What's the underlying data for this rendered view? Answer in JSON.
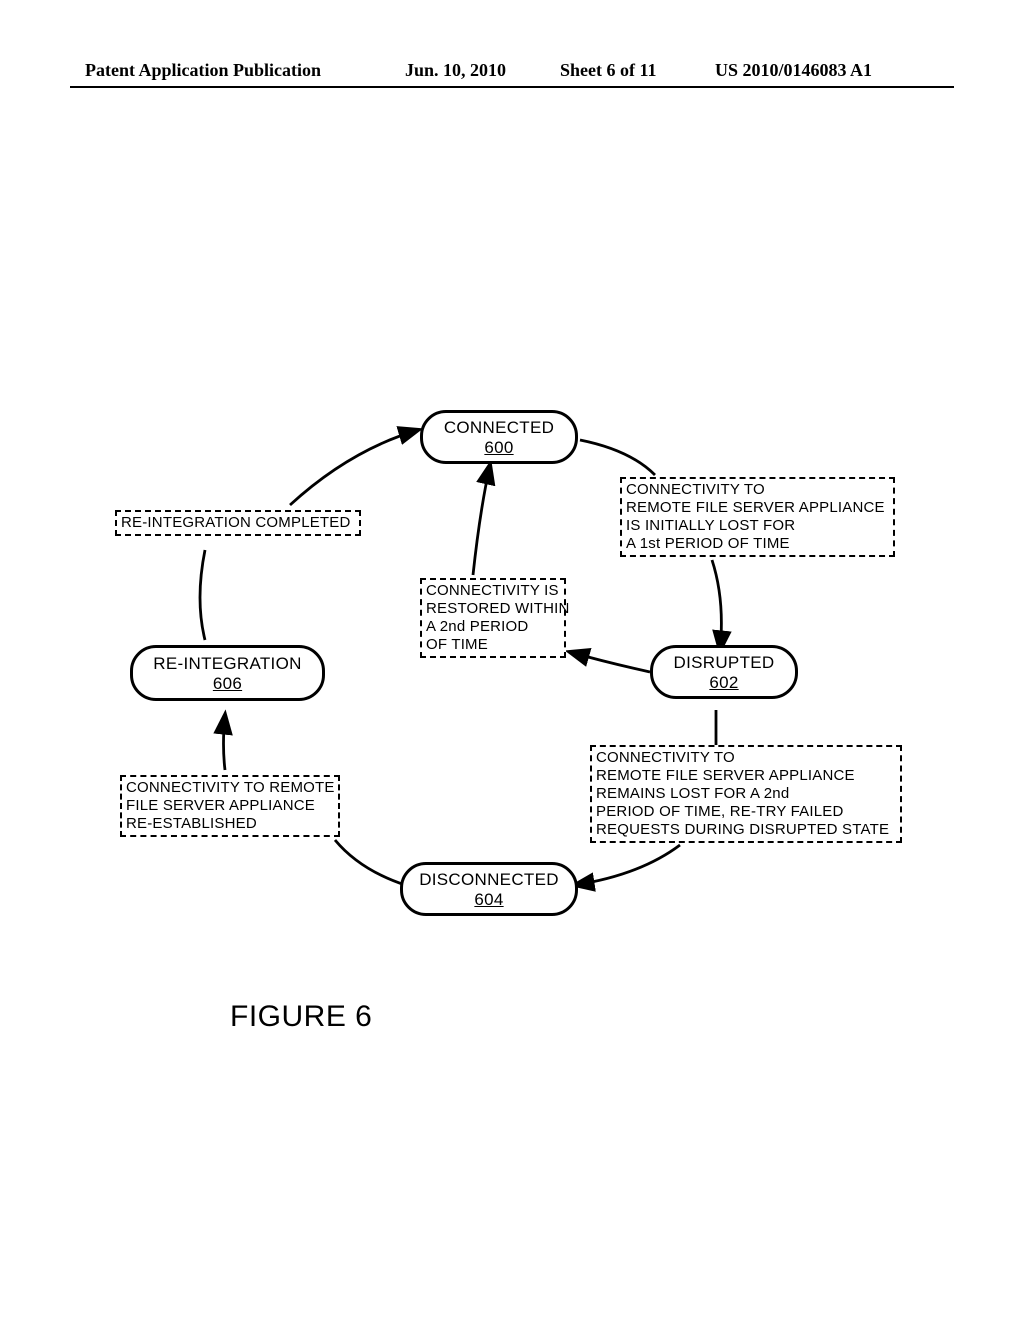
{
  "header": {
    "left": "Patent Application Publication",
    "date": "Jun. 10, 2010",
    "sheet": "Sheet 6 of 11",
    "pub_number": "US 2010/0146083 A1"
  },
  "figure_caption": "FIGURE 6",
  "chart_data": {
    "type": "state-diagram",
    "states": [
      {
        "id": "600",
        "name": "CONNECTED",
        "ref": "600"
      },
      {
        "id": "602",
        "name": "DISRUPTED",
        "ref": "602"
      },
      {
        "id": "604",
        "name": "DISCONNECTED",
        "ref": "604"
      },
      {
        "id": "606",
        "name": "RE-INTEGRATION",
        "ref": "606"
      }
    ],
    "transitions": [
      {
        "from": "600",
        "to": "602",
        "label": "CONNECTIVITY TO\nREMOTE FILE SERVER APPLIANCE\nIS INITIALLY LOST FOR\nA 1st PERIOD OF TIME"
      },
      {
        "from": "602",
        "to": "600",
        "label": "CONNECTIVITY IS\nRESTORED WITHIN\nA 2nd PERIOD\nOF TIME"
      },
      {
        "from": "602",
        "to": "604",
        "label": "CONNECTIVITY TO\nREMOTE FILE SERVER APPLIANCE\nREMAINS LOST FOR A 2nd\nPERIOD OF TIME, RE-TRY FAILED\nREQUESTS DURING DISRUPTED STATE"
      },
      {
        "from": "604",
        "to": "606",
        "label": "CONNECTIVITY TO REMOTE\nFILE SERVER APPLIANCE\nRE-ESTABLISHED"
      },
      {
        "from": "606",
        "to": "600",
        "label": "RE-INTEGRATION COMPLETED"
      }
    ]
  }
}
